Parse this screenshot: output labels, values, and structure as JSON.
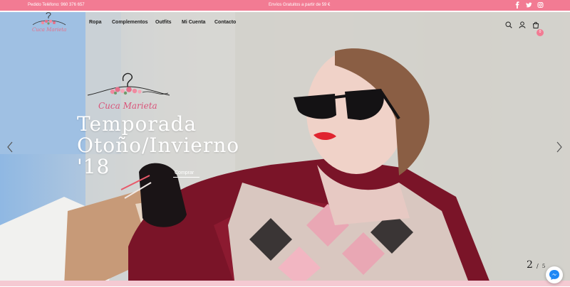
{
  "topbar": {
    "phone": "Pedido Teléfono: 960 376 657",
    "promo": "Envíos Gratuitos a partir de 59 €",
    "social": [
      "facebook-icon",
      "twitter-icon",
      "instagram-icon"
    ]
  },
  "header": {
    "logo_text": "Cuca Marieta",
    "nav": [
      "Ropa",
      "Complementos",
      "Outfits",
      "Mi Cuenta",
      "Contacto"
    ],
    "cart_count": "0"
  },
  "hero": {
    "logo_text": "Cuca Marieta",
    "title_lines": [
      "Temporada",
      "Otoño/Invierno",
      "'18"
    ],
    "cta": "Comprar",
    "slide_current": "2",
    "slide_separator": "/",
    "slide_total": "5"
  },
  "colors": {
    "accent": "#f27b93",
    "nav_text": "#222222",
    "hero_text": "#ffffff"
  }
}
